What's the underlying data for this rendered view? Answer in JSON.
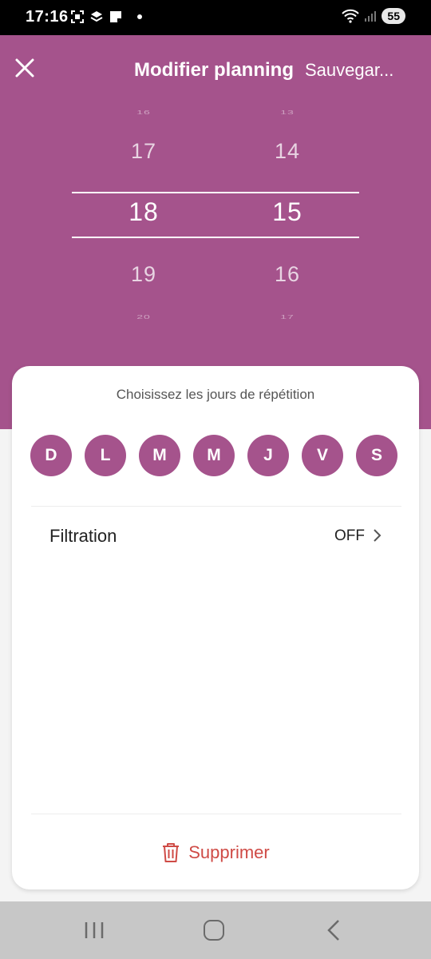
{
  "status_bar": {
    "time": "17:16",
    "battery": "55"
  },
  "header": {
    "title": "Modifier planning",
    "save_label": "Sauvegar..."
  },
  "picker": {
    "hours": [
      "16",
      "17",
      "18",
      "19",
      "20"
    ],
    "minutes": [
      "13",
      "14",
      "15",
      "16",
      "17"
    ]
  },
  "repeat": {
    "title": "Choisissez les jours de répétition",
    "days": [
      "D",
      "L",
      "M",
      "M",
      "J",
      "V",
      "S"
    ]
  },
  "filtration": {
    "label": "Filtration",
    "value": "OFF"
  },
  "delete_label": "Supprimer",
  "colors": {
    "accent": "#a5538c",
    "danger": "#cf4b46"
  }
}
